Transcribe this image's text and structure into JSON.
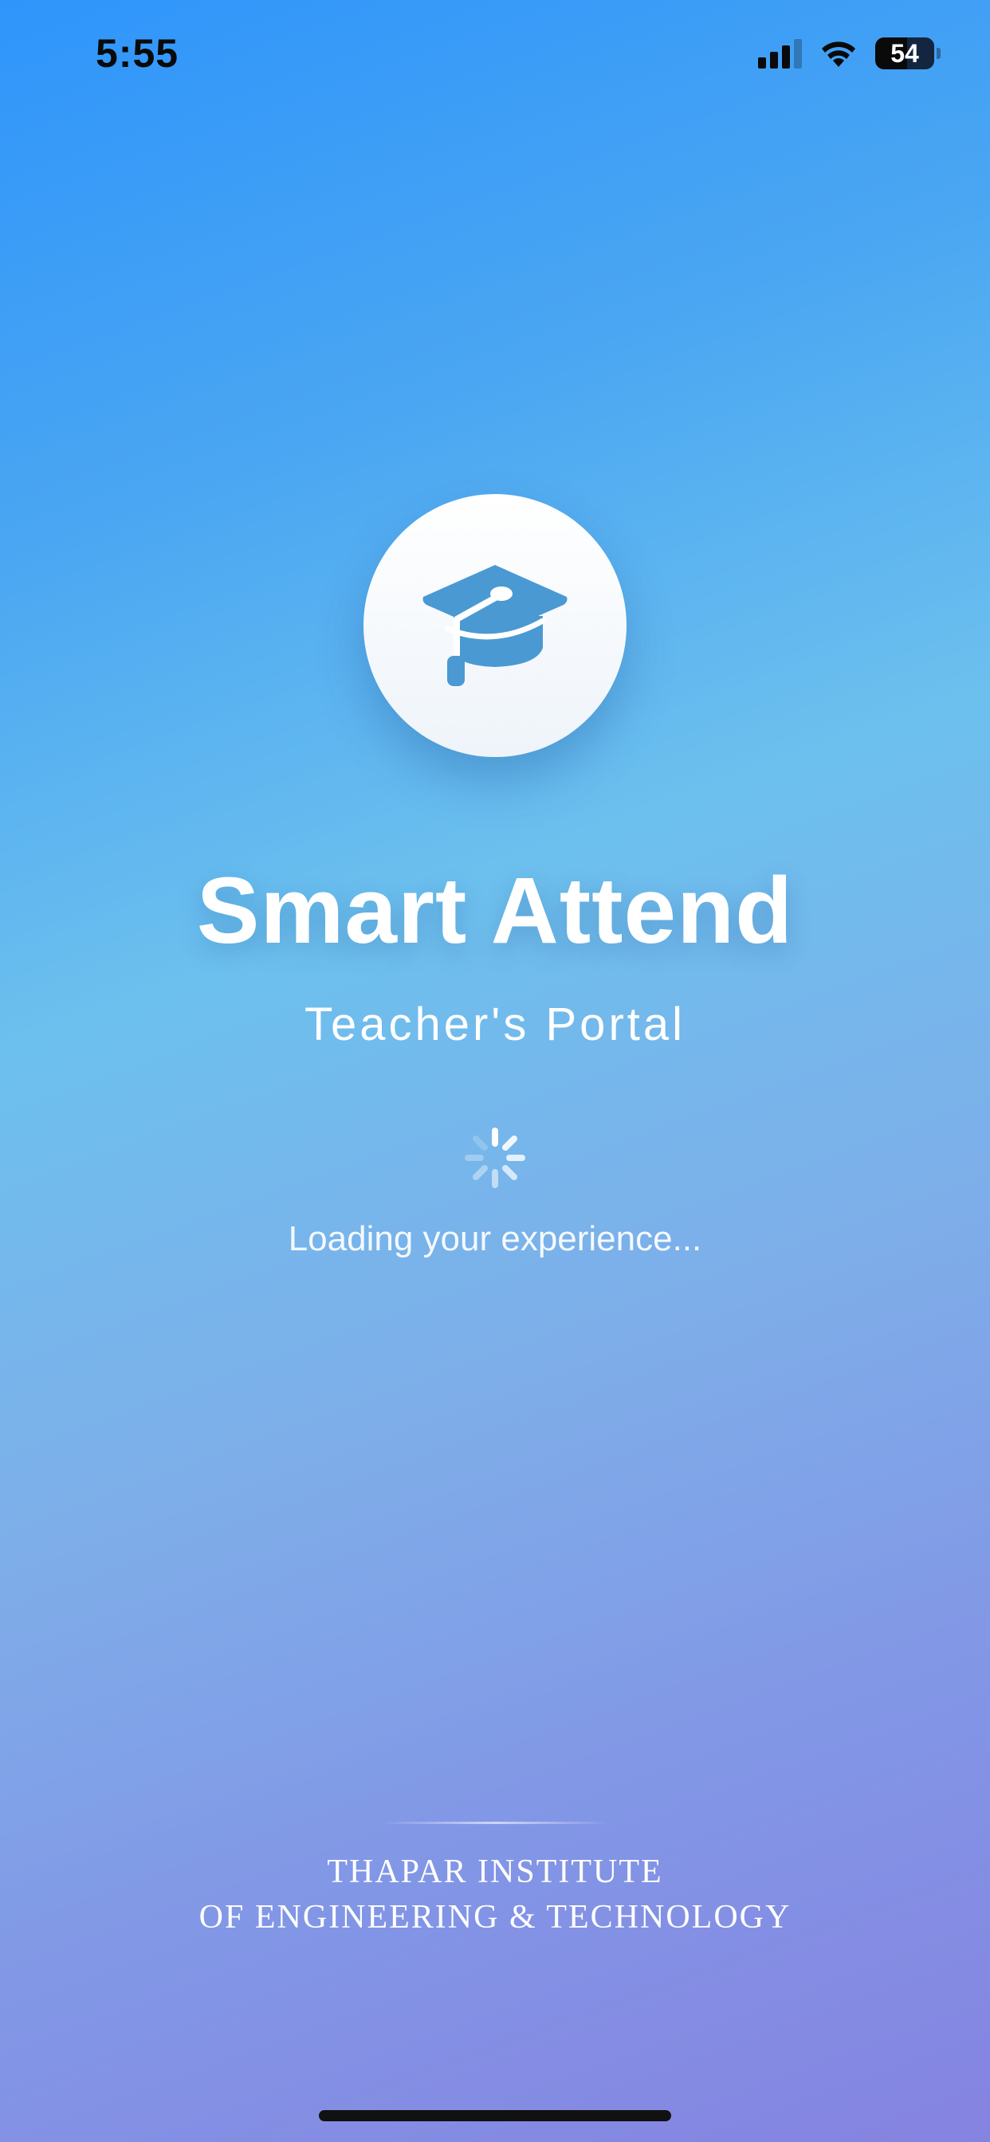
{
  "status_bar": {
    "time": "5:55",
    "battery": "54",
    "signal_bars": 3,
    "icons": [
      "cellular-signal-icon",
      "wifi-icon",
      "battery-icon"
    ]
  },
  "logo": {
    "icon": "graduation-cap-icon",
    "icon_color": "#4a99d3"
  },
  "title": "Smart Attend",
  "subtitle": "Teacher's Portal",
  "loading": {
    "icon": "spinner-icon",
    "text": "Loading your experience..."
  },
  "institute": {
    "line1": "THAPAR INSTITUTE",
    "line2": "OF ENGINEERING & TECHNOLOGY"
  },
  "colors": {
    "gradient_top": "#2f95fb",
    "gradient_middle": "#6cc0ee",
    "gradient_bottom": "#8583e0",
    "text": "#ffffff"
  }
}
